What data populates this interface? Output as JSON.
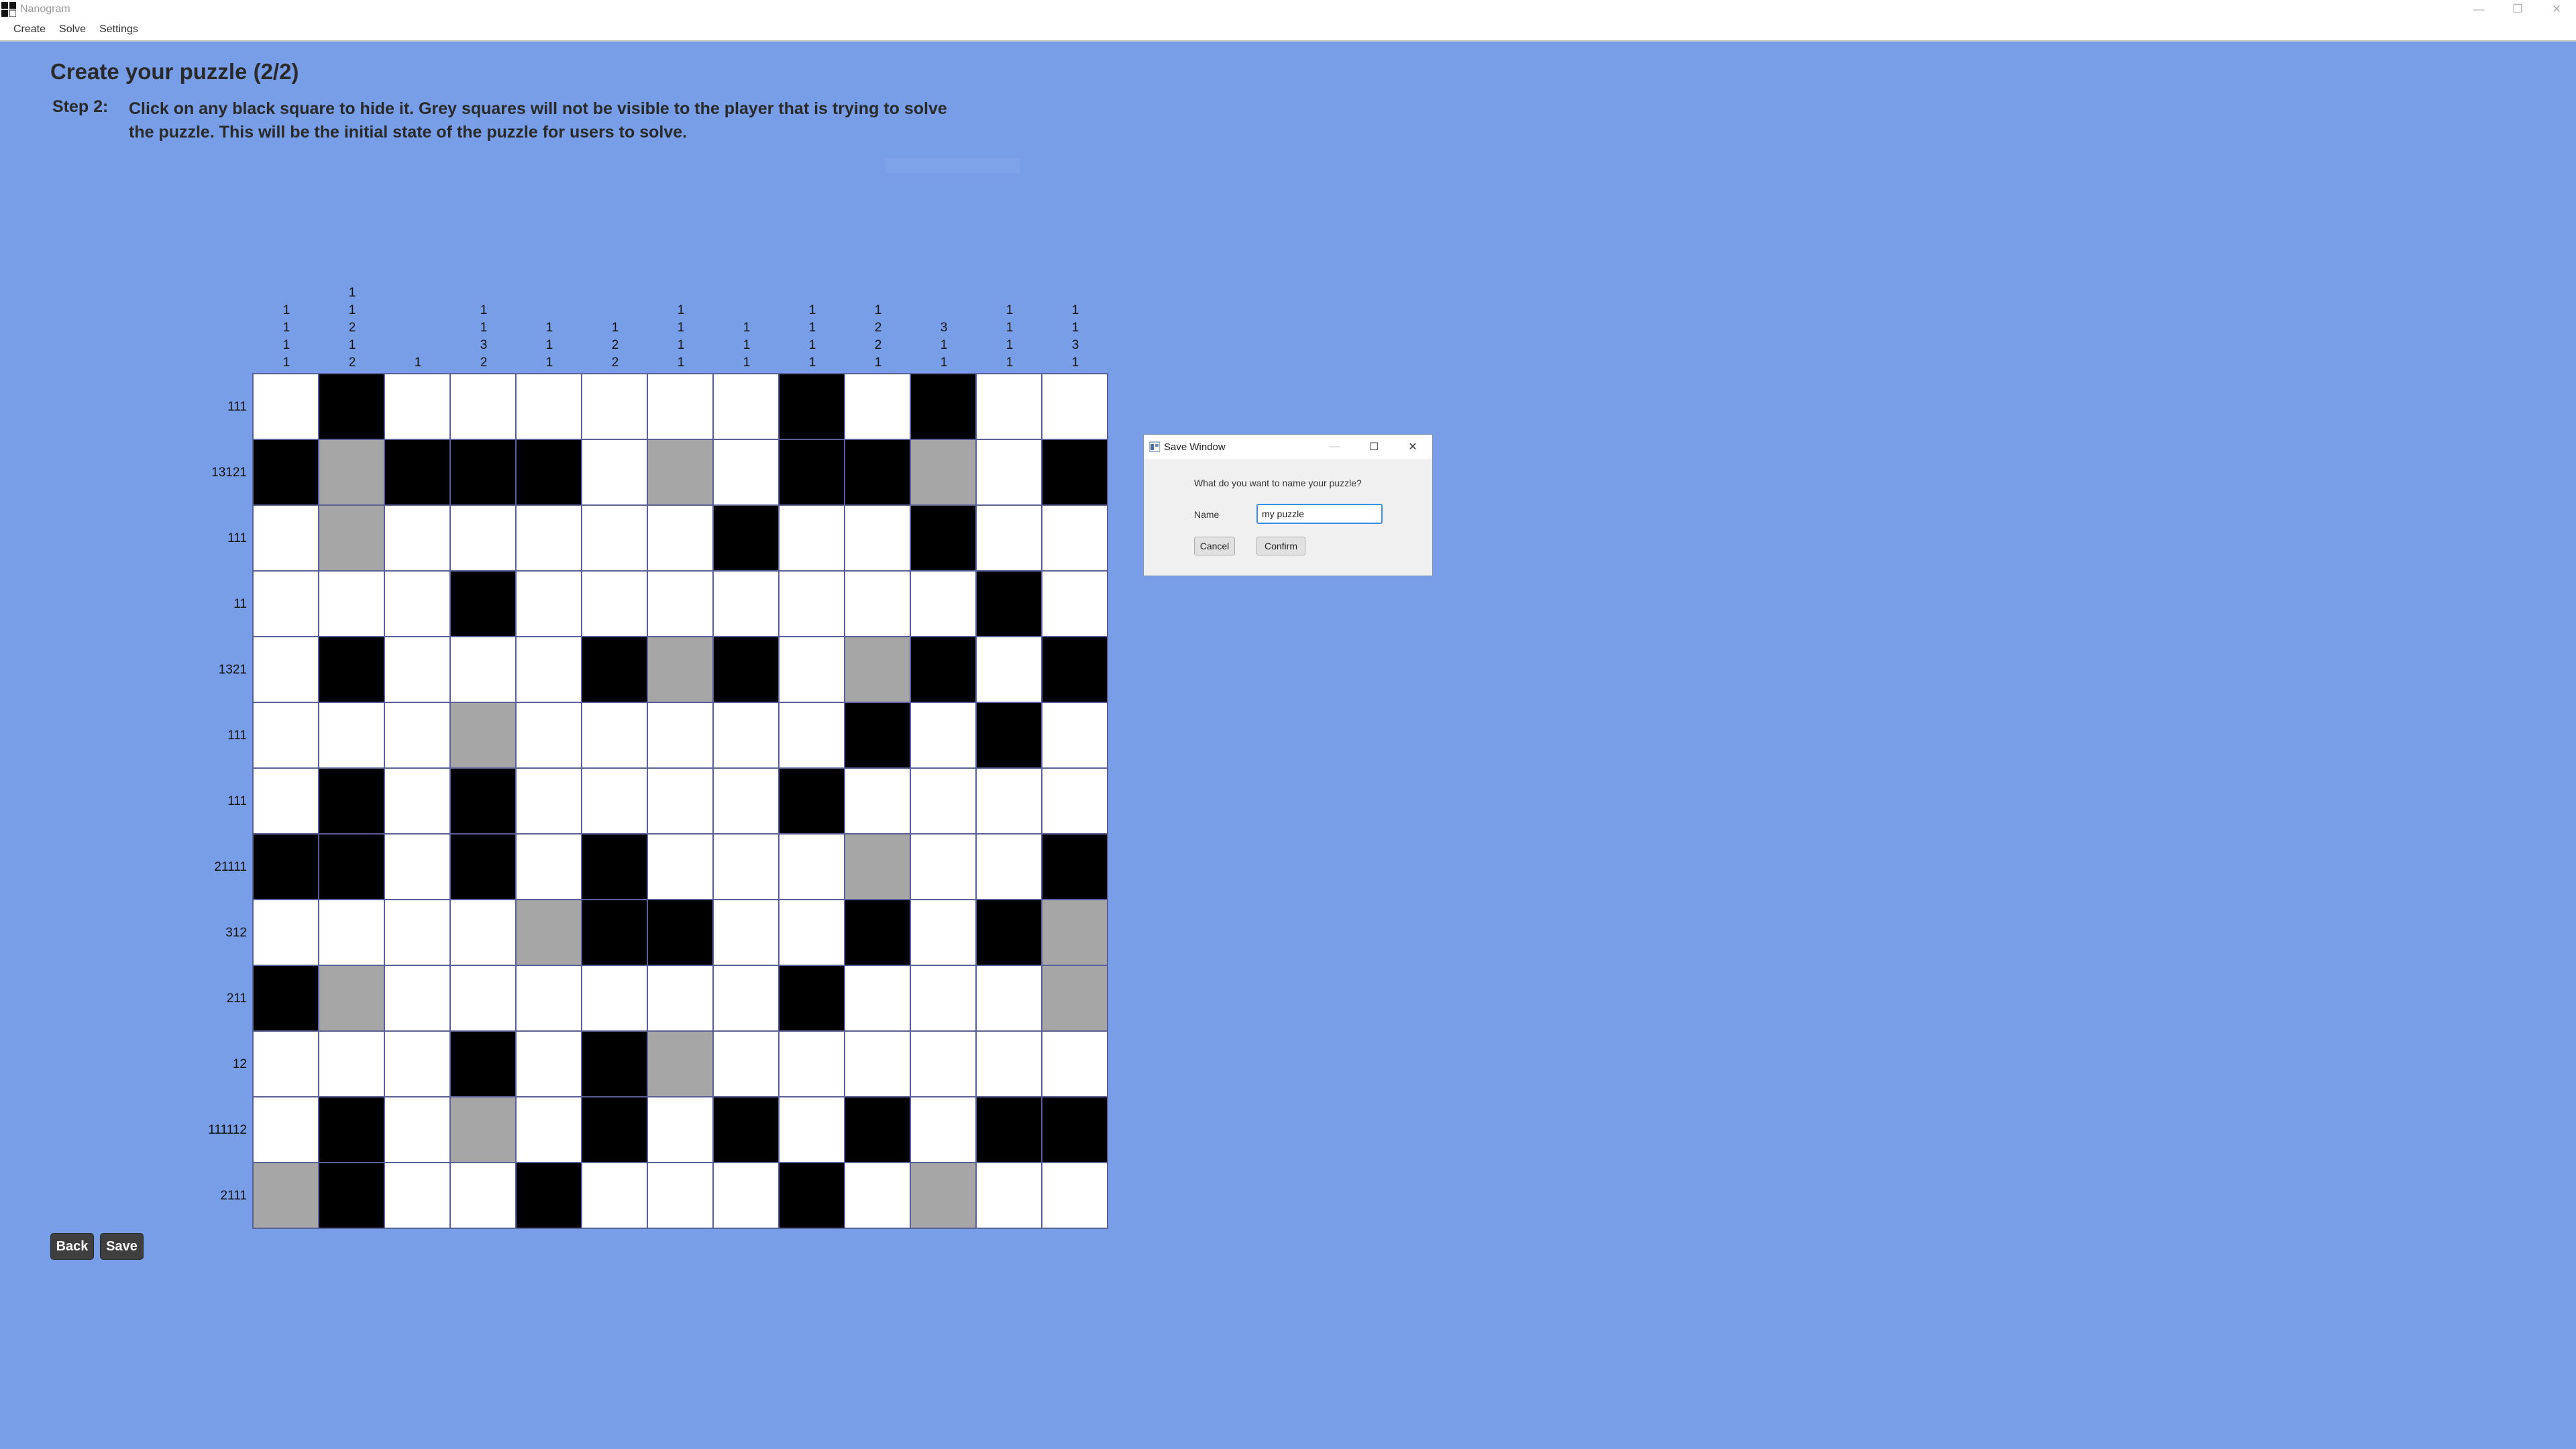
{
  "window": {
    "title": "Nanogram",
    "min_glyph": "—",
    "max_glyph": "❐",
    "close_glyph": "✕"
  },
  "menu": [
    "Create",
    "Solve",
    "Settings"
  ],
  "heading": {
    "title": "Create your puzzle (2/2)",
    "step_label": "Step 2:",
    "step_text": "Click on any black square to hide it. Grey squares will not be visible to the player that is trying to solve the puzzle. This will be the initial state of the puzzle for users to solve."
  },
  "puzzle": {
    "column_clues": [
      [
        "1",
        "1",
        "1",
        "1"
      ],
      [
        "1",
        "1",
        "2",
        "1",
        "2"
      ],
      [
        "1"
      ],
      [
        "1",
        "1",
        "3",
        "2"
      ],
      [
        "1",
        "1",
        "1"
      ],
      [
        "1",
        "2",
        "2"
      ],
      [
        "1",
        "1",
        "1",
        "1"
      ],
      [
        "1",
        "1",
        "1"
      ],
      [
        "1",
        "1",
        "1",
        "1"
      ],
      [
        "1",
        "2",
        "2",
        "1"
      ],
      [
        "3",
        "1",
        "1"
      ],
      [
        "1",
        "1",
        "1",
        "1"
      ],
      [
        "1",
        "1",
        "3",
        "1"
      ]
    ],
    "row_clues": [
      "111",
      "13121",
      "111",
      "11",
      "1321",
      "111",
      "111",
      "21111",
      "312",
      "211",
      "12",
      "111112",
      "2111"
    ],
    "grid": [
      "0100000010100",
      "1211102011201",
      "0200000100100",
      "0001000000010",
      "0100012102101",
      "0002000001010",
      "0101000010000",
      "1101010002001",
      "0000211001012",
      "1200000010002",
      "0001012000000",
      "0102010101011",
      "2100100010200"
    ],
    "legend": {
      "0": "white",
      "1": "black",
      "2": "grey"
    }
  },
  "buttons": {
    "back": "Back",
    "save": "Save"
  },
  "dialog": {
    "title": "Save Window",
    "prompt": "What do you want to name your puzzle?",
    "name_label": "Name",
    "name_value": "my puzzle",
    "cancel": "Cancel",
    "confirm": "Confirm",
    "min_glyph": "—",
    "max_glyph": "☐",
    "close_glyph": "✕"
  },
  "colors": {
    "background": "#779ee7",
    "black_cell": "#000000",
    "grey_cell": "#a6a6a6",
    "white_cell": "#ffffff",
    "grid_line": "#5a5f96",
    "input_focus": "#3b8ee8"
  }
}
